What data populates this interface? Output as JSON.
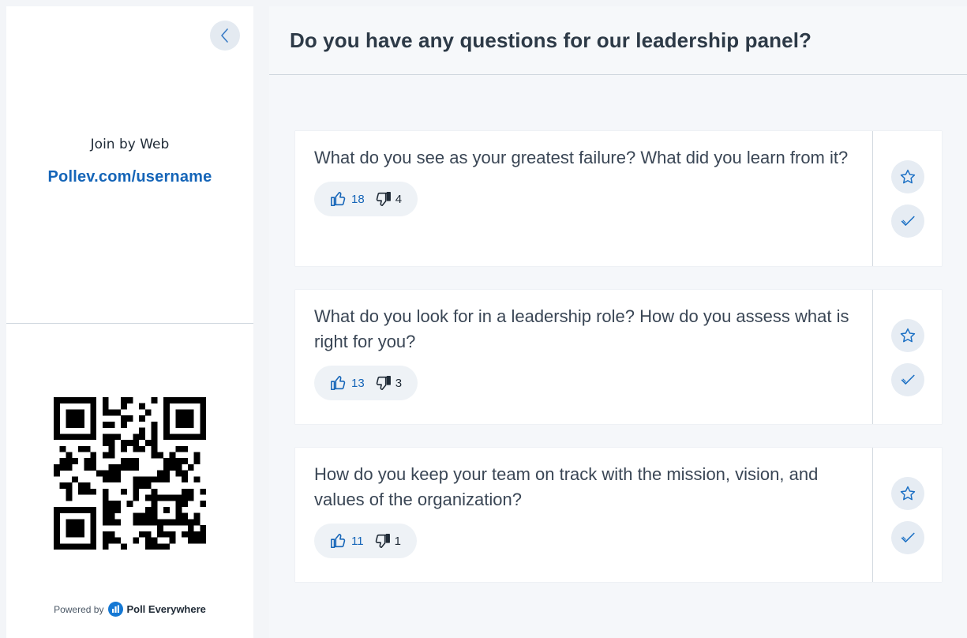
{
  "sidebar": {
    "join_label": "Join by Web",
    "join_url": "Pollev.com/username",
    "powered_by": "Powered by",
    "brand_name": "Poll Everywhere"
  },
  "main": {
    "title": "Do you have any questions for our leadership panel?",
    "questions": [
      {
        "text": "What do you see as your greatest failure? What did you learn from it?",
        "upvotes": "18",
        "downvotes": "4"
      },
      {
        "text": "What do you look for in a leadership role? How do you assess what is right for you?",
        "upvotes": "13",
        "downvotes": "3"
      },
      {
        "text": "How do you keep your team on track with the mission, vision, and values of the organization?",
        "upvotes": "11",
        "downvotes": "1"
      }
    ]
  },
  "colors": {
    "accent": "#1565b8",
    "brand": "#1478d4",
    "button_bg": "#e6ecf3"
  },
  "icons": {
    "collapse": "chevron-left-icon",
    "star": "star-icon",
    "check": "check-icon",
    "upvote": "thumbs-up-icon",
    "downvote": "thumbs-down-icon"
  }
}
